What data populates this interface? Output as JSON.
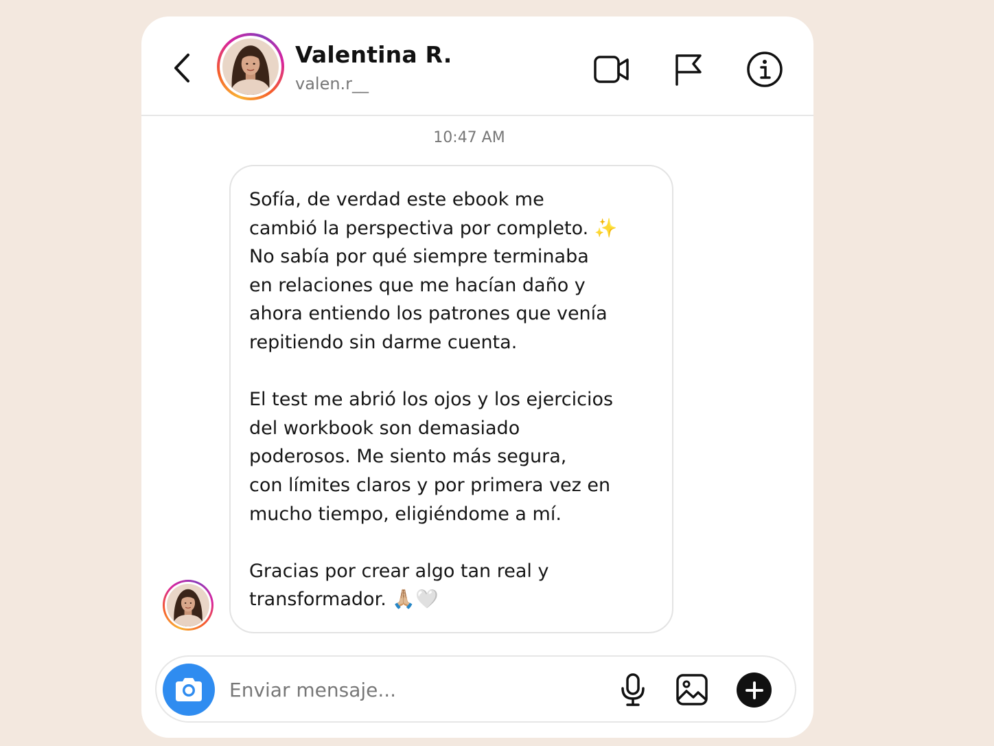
{
  "header": {
    "name": "Valentina R.",
    "username": "valen.r__",
    "back_icon": "chevron-left-icon",
    "icons": [
      "video-camera-icon",
      "flag-icon",
      "info-icon"
    ]
  },
  "conversation": {
    "timestamp": "10:47 AM",
    "message": {
      "paragraphs": [
        "Sofía, de verdad este ebook me\ncambió la perspectiva por completo. ✨\nNo sabía por qué siempre terminaba\nen relaciones que me hacían daño y\nahora entiendo los patrones que venía\nrepitiendo sin darme cuenta.",
        "El test me abrió los ojos y los ejercicios\ndel workbook son demasiado\npoderosos. Me siento más segura,\ncon límites claros y por primera vez en\nmucho tiempo, eligiéndome a mí.",
        "Gracias por crear algo tan real y\ntransformador. 🙏🏼🤍"
      ]
    }
  },
  "composer": {
    "placeholder": "Enviar mensaje...",
    "value": "",
    "icons": [
      "camera-icon",
      "microphone-icon",
      "image-icon",
      "plus-icon"
    ]
  },
  "colors": {
    "background": "#f3e8df",
    "card": "#ffffff",
    "accent_blue": "#2f8cf0",
    "avatar_ring": [
      "#f9b233",
      "#f55d2c",
      "#d6249f",
      "#8a3ab9"
    ],
    "muted_text": "#777777"
  }
}
